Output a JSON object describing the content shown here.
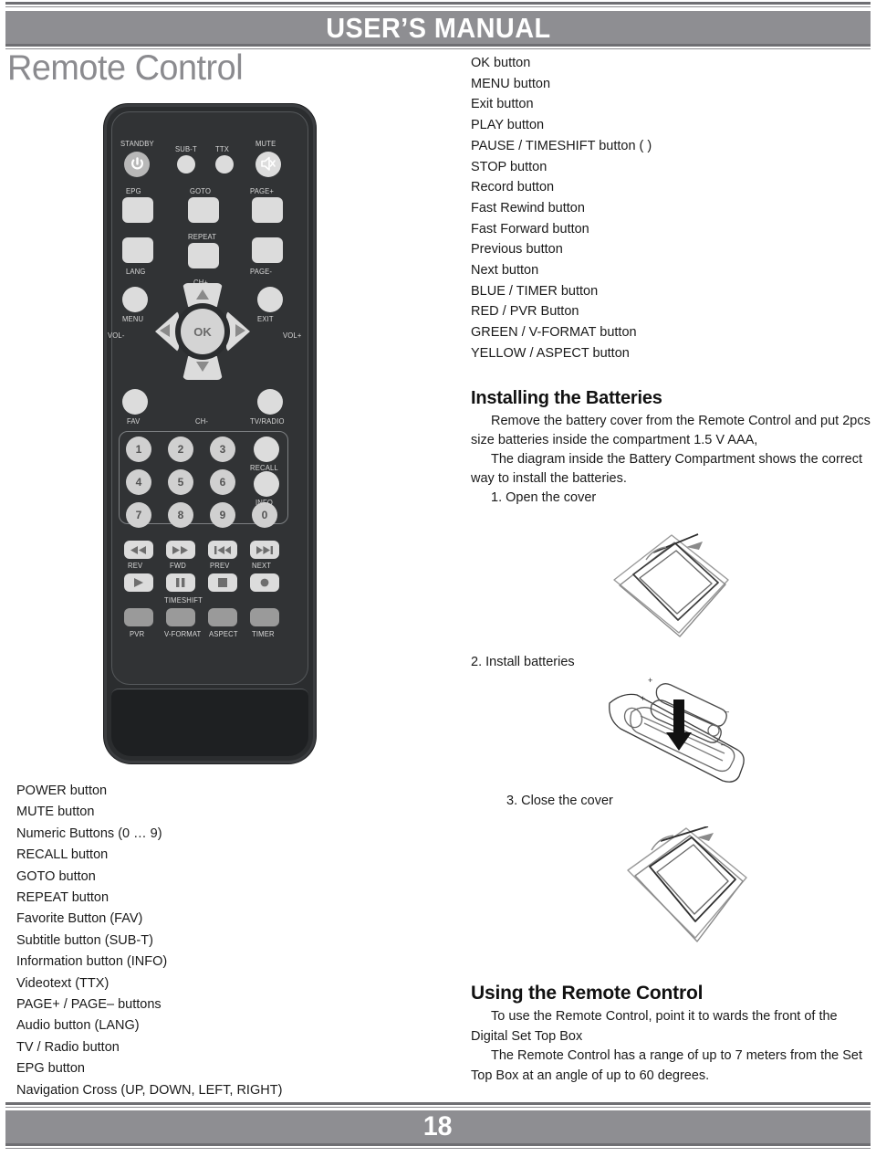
{
  "header": {
    "title": "USER’S MANUAL"
  },
  "page_title": "Remote Control",
  "footer": {
    "page_number": "18"
  },
  "colors": {
    "bar_gray": "#8e8e92",
    "title_gray": "#8b8b8f",
    "rule_gray": "#6f6f73",
    "remote_body": "#2b2d2f",
    "remote_button": "#dcdcdc",
    "text_black": "#1a1a1a"
  },
  "right_button_list": [
    "OK button",
    "MENU button",
    "Exit button",
    "PLAY button",
    "PAUSE / TIMESHIFT button ( )",
    "STOP button",
    "Record button",
    "Fast Rewind button",
    "Fast Forward button",
    "Previous button",
    "Next button",
    "BLUE / TIMER button",
    "RED / PVR Button",
    "GREEN / V-FORMAT button",
    "YELLOW / ASPECT button"
  ],
  "left_button_list": [
    "POWER button",
    "MUTE button",
    "Numeric Buttons (0 … 9)",
    "RECALL button",
    "GOTO button",
    "REPEAT button",
    "Favorite Button (FAV)",
    "Subtitle button (SUB-T)",
    "Information button (INFO)",
    "Videotext (TTX)",
    "PAGE+ / PAGE– buttons",
    "Audio button (LANG)",
    "TV / Radio button",
    "EPG button",
    "Navigation Cross (UP, DOWN, LEFT, RIGHT)"
  ],
  "installing": {
    "heading": "Installing the Batteries",
    "para1": "Remove the battery cover from the Remote Control and put 2pcs size batteries inside the compartment 1.5 V AAA,",
    "para2": "The diagram inside the Battery Compartment shows the correct way to install the batteries.",
    "step1": "1. Open the cover",
    "step2": "2. Install batteries",
    "step3": "3. Close the cover"
  },
  "using": {
    "heading": "Using the Remote Control",
    "para1": "To use the Remote Control, point it to wards the front of the Digital Set Top Box",
    "para2": "The Remote Control has a range of up to 7 meters from the Set Top Box at an angle of up to 60 degrees."
  },
  "remote_labels": {
    "standby": "STANDBY",
    "subt": "SUB-T",
    "ttx": "TTX",
    "mute": "MUTE",
    "epg": "EPG",
    "goto": "GOTO",
    "pageplus": "PAGE+",
    "repeat": "REPEAT",
    "lang": "LANG",
    "pageminus": "PAGE-",
    "chplus": "CH+",
    "menu": "MENU",
    "exit": "EXIT",
    "volminus": "VOL-",
    "volplus": "VOL+",
    "ok": "OK",
    "fav": "FAV",
    "chminus": "CH-",
    "tvradio": "TV/RADIO",
    "recall": "RECALL",
    "info": "INFO",
    "rev": "REV",
    "fwd": "FWD",
    "prev": "PREV",
    "next": "NEXT",
    "timeshift": "TIMESHIFT",
    "pvr": "PVR",
    "vformat": "V-FORMAT",
    "aspect": "ASPECT",
    "timer": "TIMER",
    "numbers": [
      "1",
      "2",
      "3",
      "4",
      "5",
      "6",
      "7",
      "8",
      "9",
      "0"
    ]
  }
}
